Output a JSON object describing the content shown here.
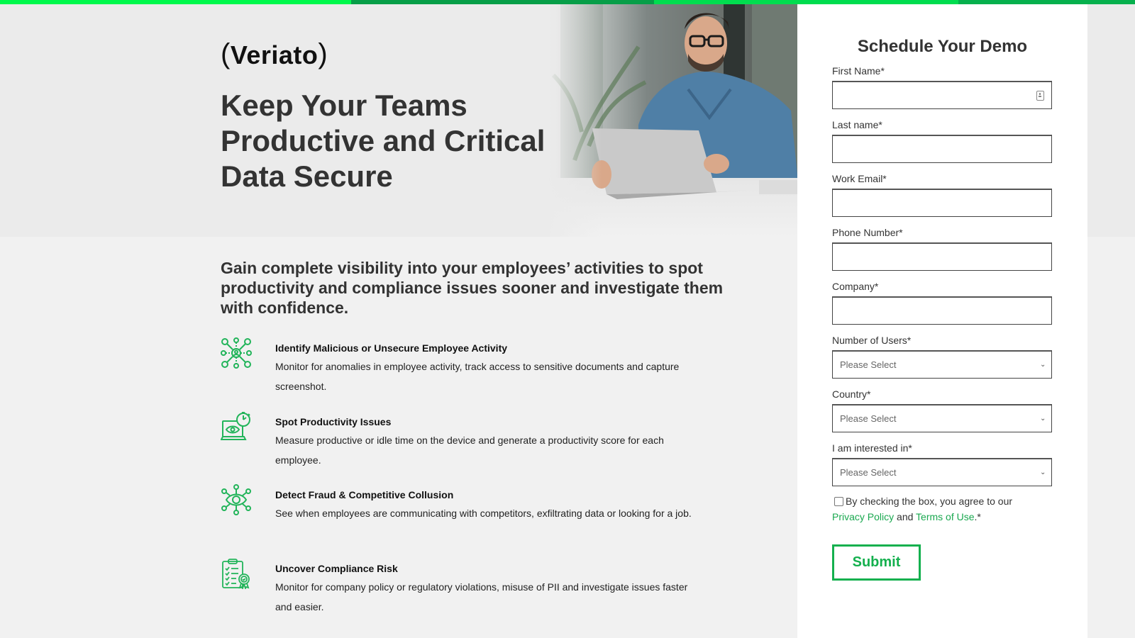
{
  "brand": {
    "logo_text": "Veriato",
    "logo_open": "(",
    "logo_close": ")",
    "accent_colors": [
      "#00f94c",
      "#079e48",
      "#00dd4f",
      "#06b04d"
    ],
    "link_color": "#19a84f",
    "button_color": "#14b04e"
  },
  "hero": {
    "title_lines": [
      "Keep Your Teams",
      "Productive and Critical",
      "Data Secure"
    ],
    "image_alt": "Man with glasses working on a laptop"
  },
  "subheading": "Gain complete visibility into your employees’ activities to spot productivity and compliance issues sooner and investigate them with confidence.",
  "features": [
    {
      "icon": "network-user-icon",
      "title": "Identify Malicious or Unsecure Employee Activity",
      "description": "Monitor for anomalies in employee activity, track access to sensitive documents and capture screenshot."
    },
    {
      "icon": "laptop-eye-stopwatch-icon",
      "title": "Spot Productivity Issues",
      "description": "Measure productive or idle time on the device and generate a productivity score for each employee."
    },
    {
      "icon": "eye-network-icon",
      "title": "Detect Fraud & Competitive Collusion",
      "description": "See when employees are communicating with competitors, exfiltrating data or looking for a job."
    },
    {
      "icon": "clipboard-badge-icon",
      "title": "Uncover Compliance Risk",
      "description": "Monitor for company policy or regulatory violations, misuse of PII and investigate issues faster and easier."
    }
  ],
  "form": {
    "title": "Schedule Your Demo",
    "fields": {
      "first_name": {
        "label": "First Name*",
        "value": ""
      },
      "last_name": {
        "label": "Last name*",
        "value": ""
      },
      "work_email": {
        "label": "Work Email*",
        "value": ""
      },
      "phone": {
        "label": "Phone Number*",
        "value": ""
      },
      "company": {
        "label": "Company*",
        "value": ""
      },
      "num_users": {
        "label": "Number of Users*",
        "selected": "Please Select"
      },
      "country": {
        "label": "Country*",
        "selected": "Please Select"
      },
      "interest": {
        "label": "I am interested in*",
        "selected": "Please Select"
      }
    },
    "consent": {
      "checked": false,
      "text_before": "By checking the box, you agree to our",
      "privacy_link": "Privacy Policy",
      "and": "and",
      "terms_link": "Terms of Use",
      "suffix": ".*"
    },
    "submit_label": "Submit"
  }
}
